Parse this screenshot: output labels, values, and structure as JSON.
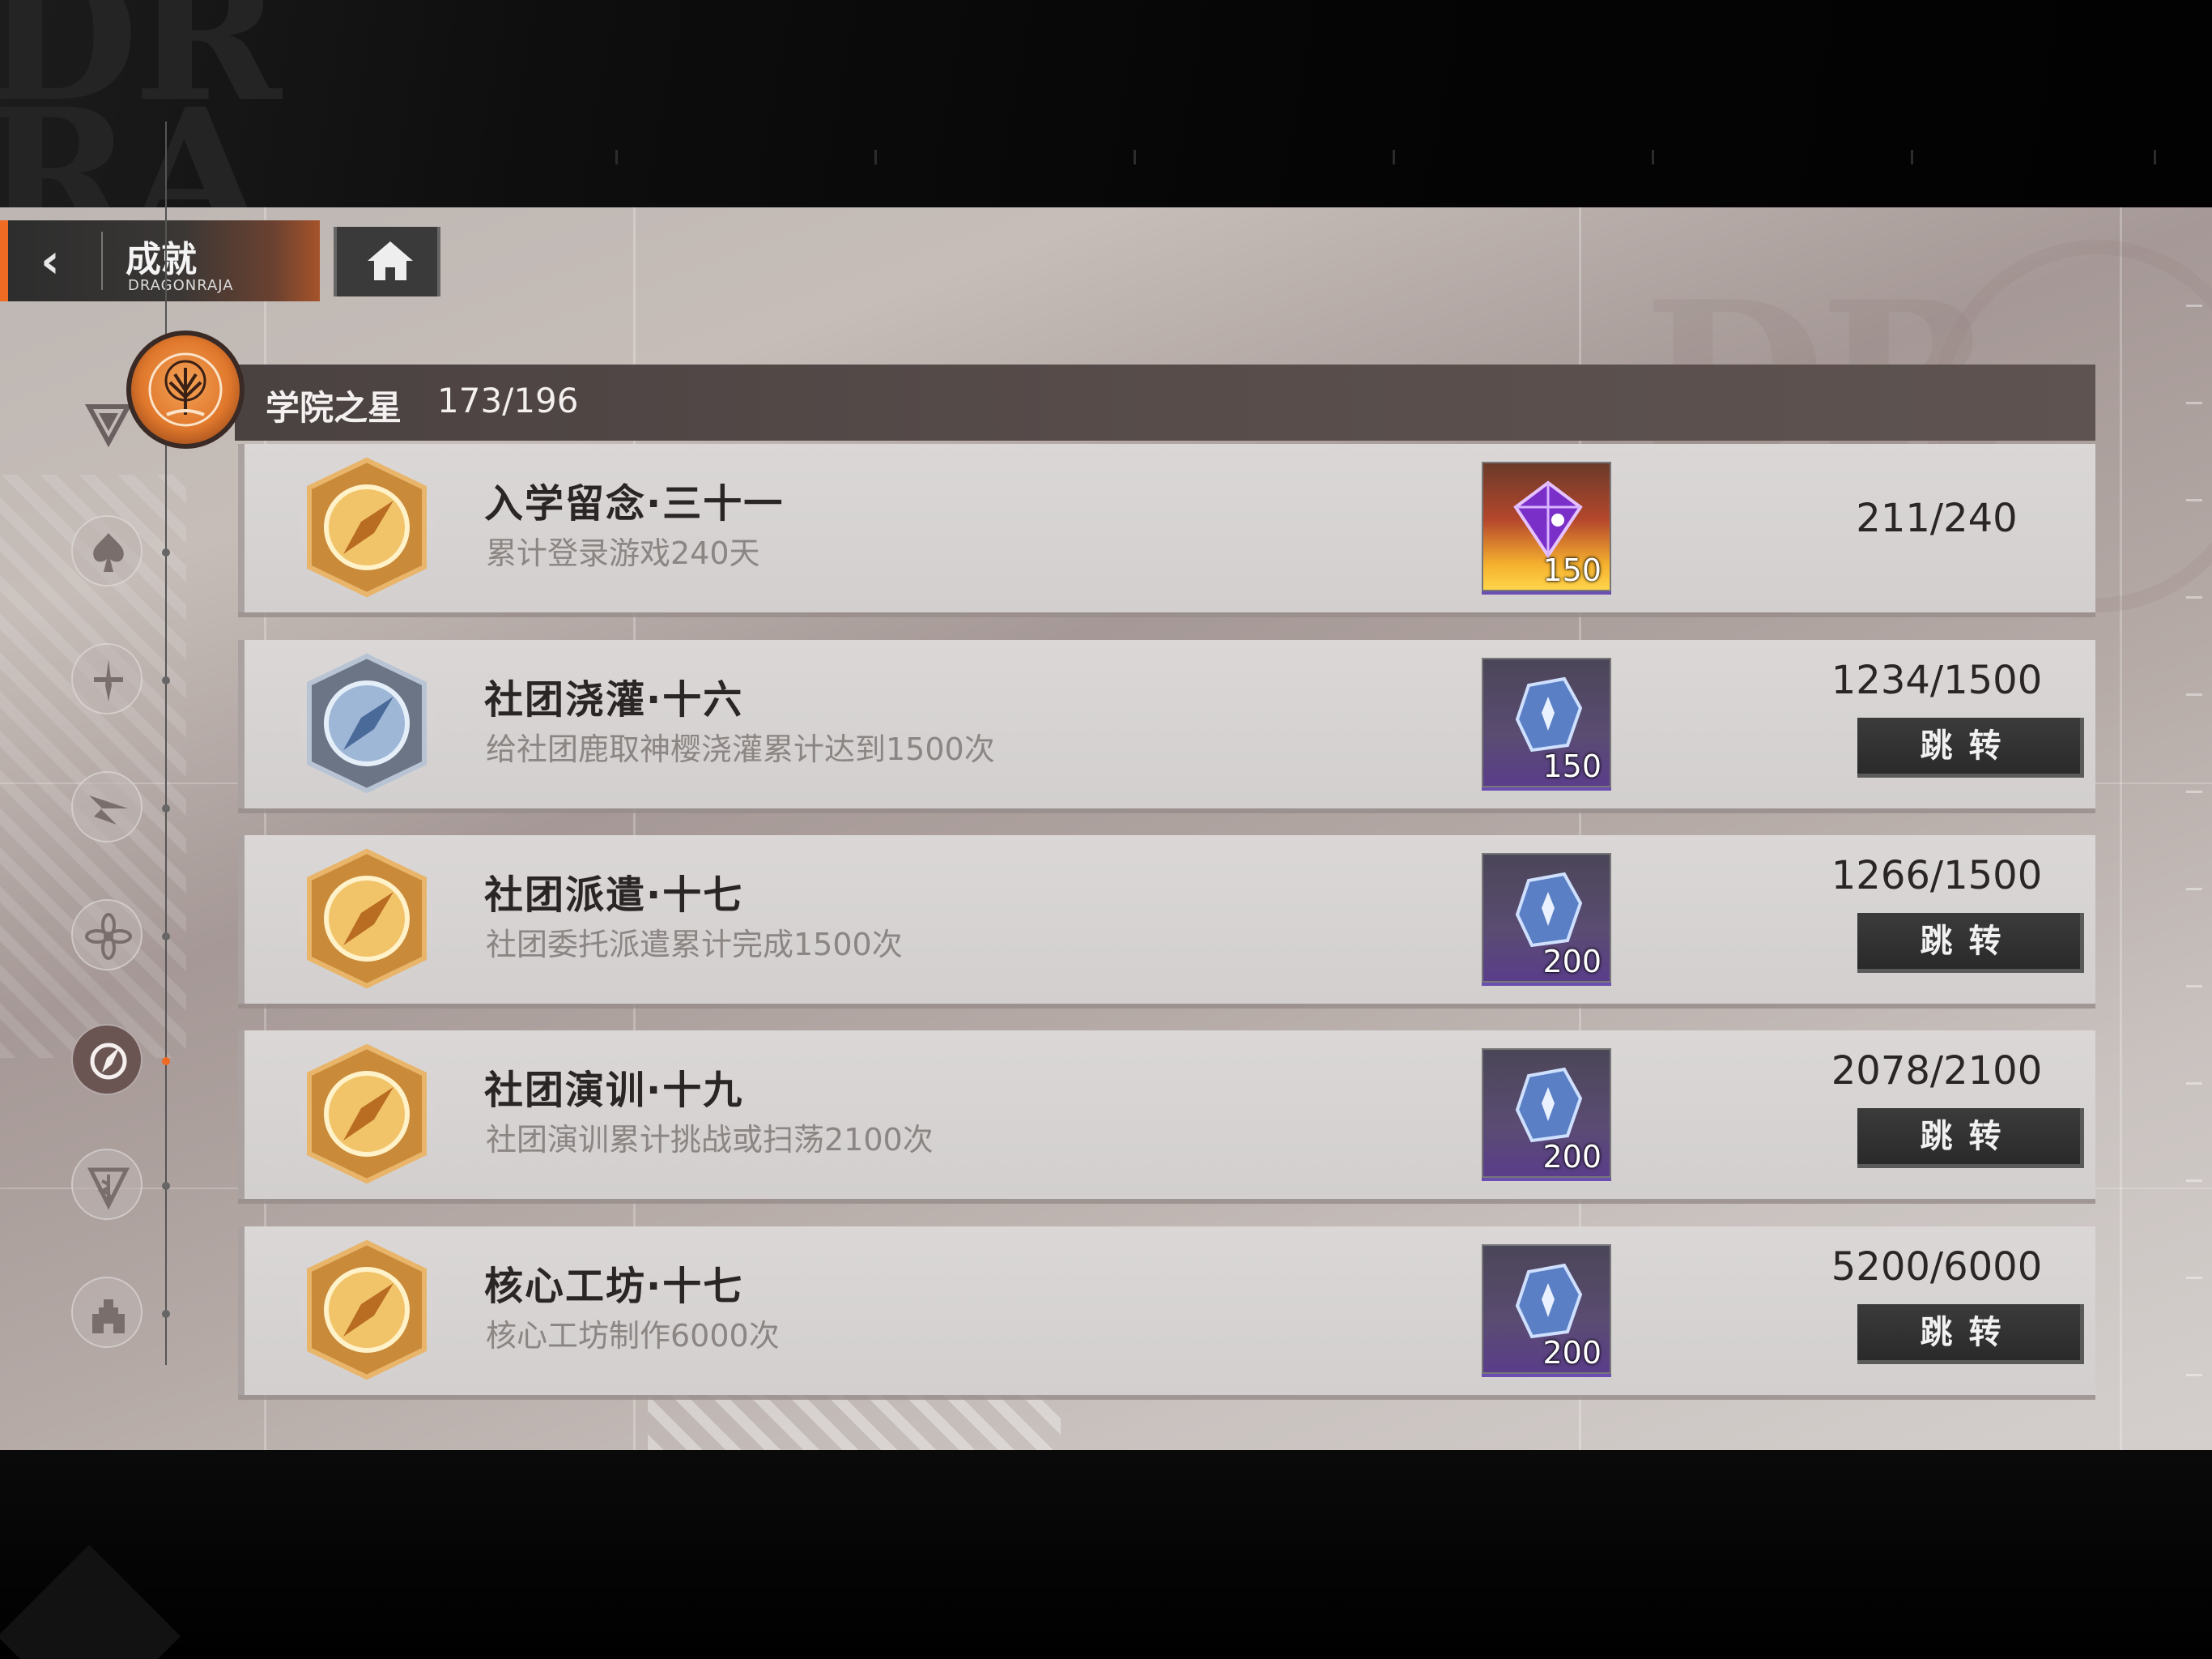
{
  "header": {
    "back_icon": "chevron-left-icon",
    "title": "成就",
    "subtitle": "DRAGONRAJA",
    "home_icon": "home-icon"
  },
  "side_nav": {
    "items": [
      {
        "icon": "spade-icon"
      },
      {
        "icon": "dagger-icon"
      },
      {
        "icon": "origami-bird-icon"
      },
      {
        "icon": "flower-icon"
      },
      {
        "icon": "compass-icon",
        "active": true
      },
      {
        "icon": "caduceus-icon"
      },
      {
        "icon": "castle-icon"
      }
    ]
  },
  "category": {
    "icon": "tree-emblem-icon",
    "name": "学院之星",
    "count": "173/196"
  },
  "achievements": [
    {
      "title": "入学留念·三十一",
      "desc": "累计登录游戏240天",
      "badge": "gold-compass-badge",
      "reward_icon": "purple-gem-icon",
      "reward_qty": "150",
      "progress": "211/240",
      "jump_label": ""
    },
    {
      "title": "社团浇灌·十六",
      "desc": "给社团鹿取神樱浇灌累计达到1500次",
      "badge": "silver-compass-badge",
      "reward_icon": "blue-crystal-icon",
      "reward_qty": "150",
      "progress": "1234/1500",
      "jump_label": "跳转"
    },
    {
      "title": "社团派遣·十七",
      "desc": "社团委托派遣累计完成1500次",
      "badge": "gold-compass-badge",
      "reward_icon": "blue-crystal-icon",
      "reward_qty": "200",
      "progress": "1266/1500",
      "jump_label": "跳转"
    },
    {
      "title": "社团演训·十九",
      "desc": "社团演训累计挑战或扫荡2100次",
      "badge": "gold-compass-badge",
      "reward_icon": "blue-crystal-icon",
      "reward_qty": "200",
      "progress": "2078/2100",
      "jump_label": "跳转"
    },
    {
      "title": "核心工坊·十七",
      "desc": "核心工坊制作6000次",
      "badge": "gold-compass-badge",
      "reward_icon": "blue-crystal-icon",
      "reward_qty": "200",
      "progress": "5200/6000",
      "jump_label": "跳转"
    }
  ]
}
